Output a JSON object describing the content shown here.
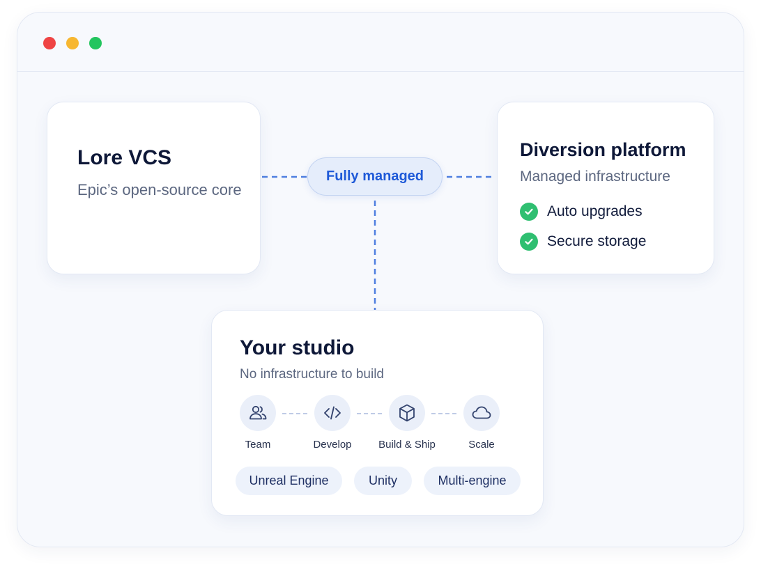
{
  "window": {
    "controls": [
      {
        "name": "close",
        "color": "#ef4444"
      },
      {
        "name": "minimize",
        "color": "#f7b731"
      },
      {
        "name": "maximize",
        "color": "#22c55e"
      }
    ]
  },
  "lore": {
    "title": "Lore VCS",
    "subtitle": "Epic’s open-source core"
  },
  "center_pill": {
    "label": "Fully managed"
  },
  "diversion": {
    "title": "Diversion platform",
    "subtitle": "Managed infrastructure",
    "features": [
      {
        "label": "Auto upgrades",
        "icon": "check-icon",
        "color": "#2fbf71"
      },
      {
        "label": "Secure storage",
        "icon": "check-icon",
        "color": "#2fbf71"
      }
    ]
  },
  "studio": {
    "title": "Your studio",
    "subtitle": "No infrastructure to build",
    "steps": [
      {
        "label": "Team",
        "icon": "team-icon"
      },
      {
        "label": "Develop",
        "icon": "code-icon"
      },
      {
        "label": "Build & Ship",
        "icon": "box-icon"
      },
      {
        "label": "Scale",
        "icon": "cloud-icon"
      }
    ],
    "tags": [
      "Unreal Engine",
      "Unity",
      "Multi-engine"
    ]
  },
  "colors": {
    "accent": "#1f5ad8",
    "connector": "#4f7fe0",
    "success": "#2fbf71",
    "title_text": "#0e1838",
    "muted_text": "#5c6780"
  }
}
